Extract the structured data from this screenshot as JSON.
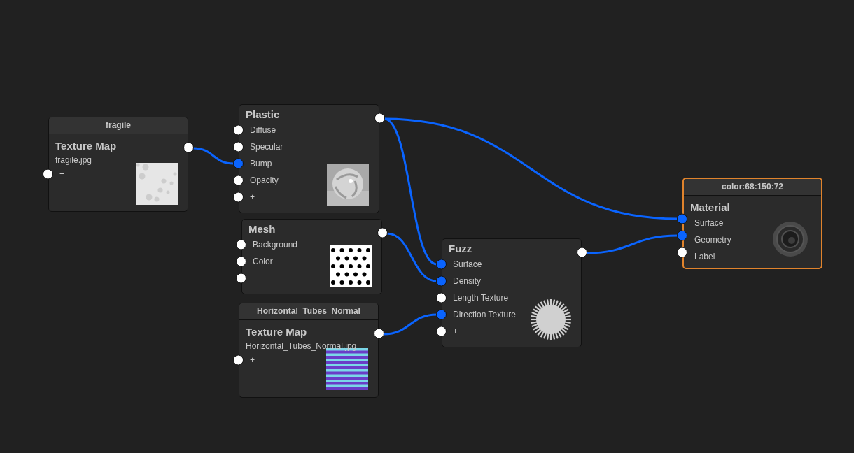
{
  "nodes": [
    {
      "header": "fragile",
      "title": "Texture Map",
      "filename": "fragile.jpg",
      "selected": false,
      "inputs": [
        {
          "label": "+",
          "connected": false
        }
      ]
    },
    {
      "title": "Plastic",
      "selected": false,
      "inputs": [
        {
          "label": "Diffuse",
          "connected": false
        },
        {
          "label": "Specular",
          "connected": false
        },
        {
          "label": "Bump",
          "connected": true
        },
        {
          "label": "Opacity",
          "connected": false
        },
        {
          "label": "+",
          "connected": false
        }
      ]
    },
    {
      "title": "Mesh",
      "selected": false,
      "inputs": [
        {
          "label": "Background",
          "connected": false
        },
        {
          "label": "Color",
          "connected": false
        },
        {
          "label": "+",
          "connected": false
        }
      ]
    },
    {
      "header": "Horizontal_Tubes_Normal",
      "title": "Texture Map",
      "filename": "Horizontal_Tubes_Normal.jpg",
      "selected": false,
      "inputs": [
        {
          "label": "+",
          "connected": false
        }
      ]
    },
    {
      "title": "Fuzz",
      "selected": false,
      "inputs": [
        {
          "label": "Surface",
          "connected": true
        },
        {
          "label": "Density",
          "connected": true
        },
        {
          "label": "Length Texture",
          "connected": false
        },
        {
          "label": "Direction Texture",
          "connected": true
        },
        {
          "label": "+",
          "connected": false
        }
      ]
    },
    {
      "header": "color:68:150:72",
      "title": "Material",
      "selected": true,
      "output": false,
      "inputs": [
        {
          "label": "Surface",
          "connected": true
        },
        {
          "label": "Geometry",
          "connected": true
        },
        {
          "label": "Label",
          "connected": false
        }
      ]
    }
  ]
}
